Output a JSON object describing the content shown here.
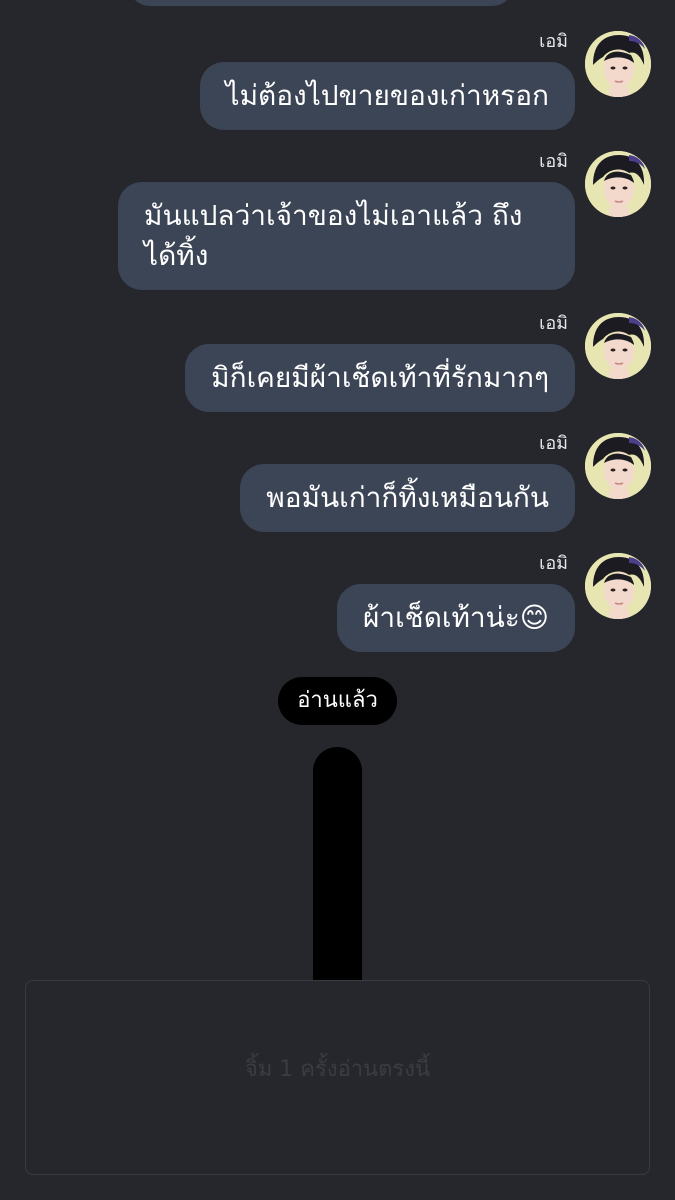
{
  "messages": [
    {
      "sender": "เอมิ",
      "text": "ไม่ต้องไปขายของเก่าหรอก"
    },
    {
      "sender": "เอมิ",
      "text": "มันแปลว่าเจ้าของไม่เอาแล้ว ถึงได้ทิ้ง"
    },
    {
      "sender": "เอมิ",
      "text": "มิก็เคยมีผ้าเช็ดเท้าที่รักมากๆ"
    },
    {
      "sender": "เอมิ",
      "text": "พอมันเก่าก็ทิ้งเหมือนกัน"
    },
    {
      "sender": "เอมิ",
      "text": "ผ้าเช็ดเท้าน่ะ😊"
    }
  ],
  "read_badge": "อ่านแล้ว",
  "input": {
    "placeholder": "จิ้ม 1 ครั้งอ่านตรงนี้"
  },
  "colors": {
    "background": "#26272c",
    "bubble": "#3c4555",
    "badge": "#000000",
    "avatar_bg": "#e7e6b3"
  }
}
